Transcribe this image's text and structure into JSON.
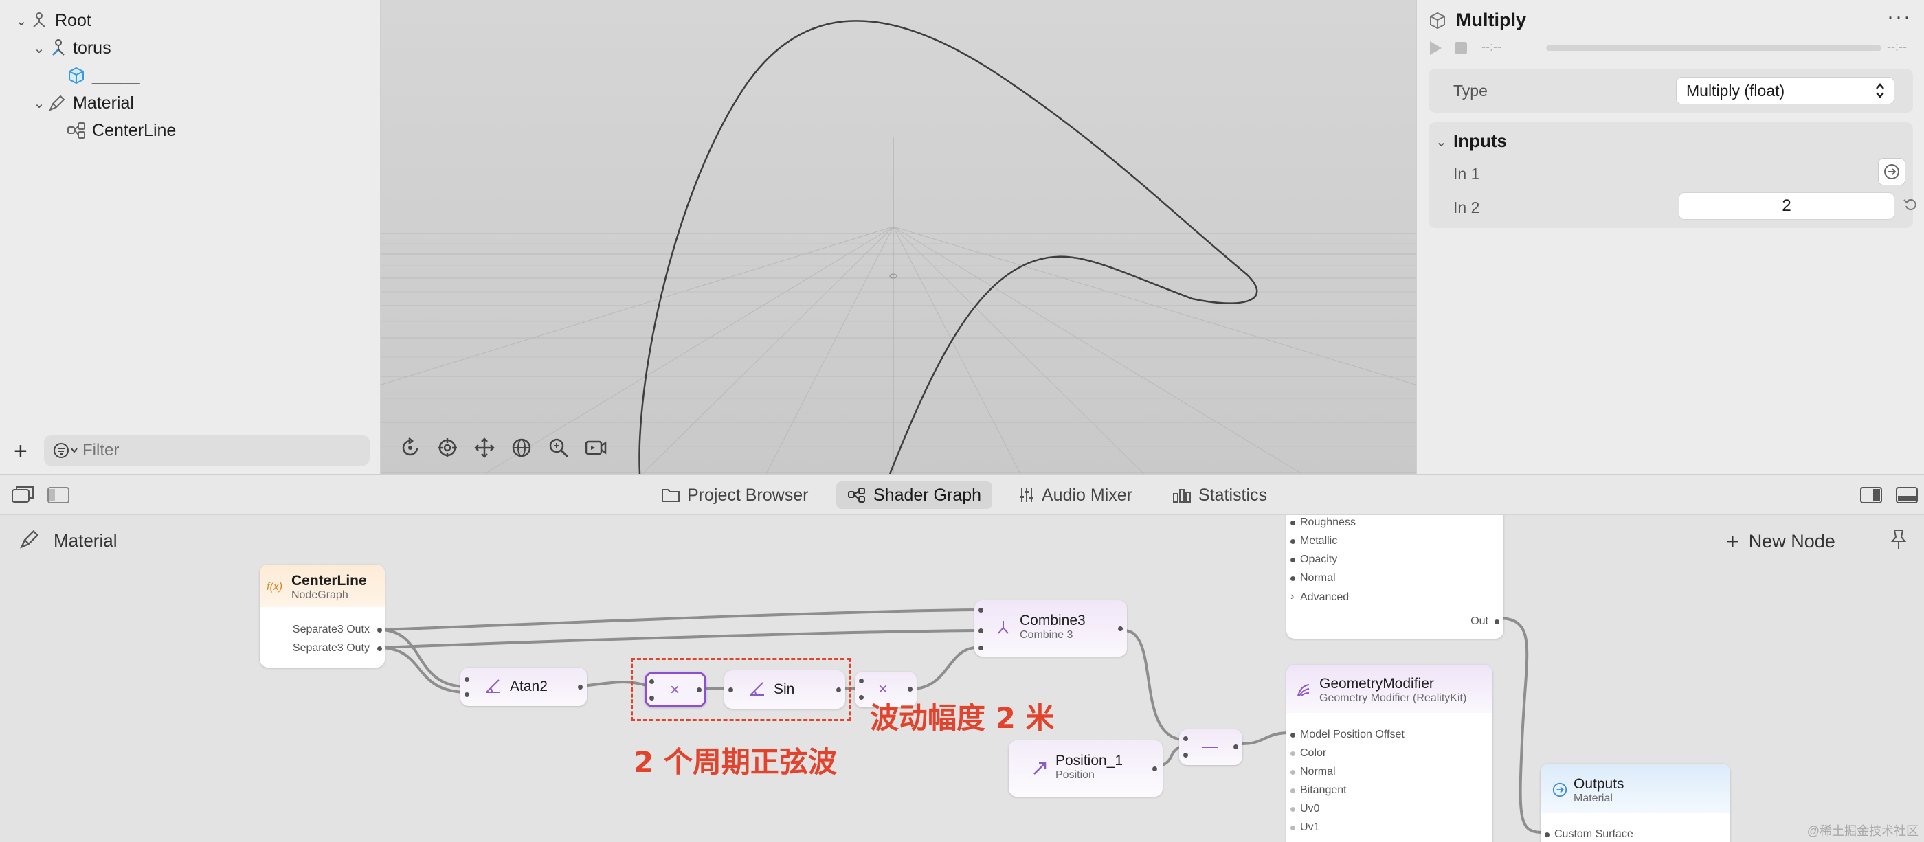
{
  "hierarchy": {
    "items": [
      {
        "label": "Root"
      },
      {
        "label": "torus"
      },
      {
        "label": "_____"
      },
      {
        "label": "Material"
      },
      {
        "label": "CenterLine"
      }
    ],
    "filter_placeholder": "Filter"
  },
  "inspector": {
    "title": "Multiply",
    "time_start": "--:--",
    "time_end": "--:--",
    "type_label": "Type",
    "type_value": "Multiply (float)",
    "inputs_header": "Inputs",
    "in1_label": "In 1",
    "in2_label": "In 2",
    "in2_value": "2"
  },
  "tabs": [
    {
      "label": "Project Browser",
      "icon": "folder-icon"
    },
    {
      "label": "Shader Graph",
      "icon": "node-graph-icon"
    },
    {
      "label": "Audio Mixer",
      "icon": "sliders-icon"
    },
    {
      "label": "Statistics",
      "icon": "bar-chart-icon"
    }
  ],
  "graph": {
    "breadcrumb": "Material",
    "new_node_label": "New Node",
    "nodes": {
      "centerline": {
        "title": "CenterLine",
        "subtitle": "NodeGraph",
        "outputs": [
          "Separate3 Outx",
          "Separate3 Outy"
        ],
        "badge": "f(x)"
      },
      "atan2": {
        "title": "Atan2"
      },
      "multiply1": {
        "symbol": "×"
      },
      "sin": {
        "title": "Sin"
      },
      "multiply2": {
        "symbol": "×"
      },
      "combine3": {
        "title": "Combine3",
        "subtitle": "Combine 3"
      },
      "position": {
        "title": "Position_1",
        "subtitle": "Position"
      },
      "subtract": {
        "symbol": "—"
      },
      "surface": {
        "ports": [
          "Roughness",
          "Metallic",
          "Opacity",
          "Normal",
          "Advanced"
        ],
        "out": "Out"
      },
      "geometry": {
        "title": "GeometryModifier",
        "subtitle": "Geometry Modifier (RealityKit)",
        "ports": [
          "Model Position Offset",
          "Color",
          "Normal",
          "Bitangent",
          "Uv0",
          "Uv1"
        ]
      },
      "outputs": {
        "title": "Outputs",
        "subtitle": "Material",
        "ports": [
          "Custom Surface"
        ]
      }
    },
    "annotations": {
      "amplitude": "波动幅度 2 米",
      "periods": "2 个周期正弦波"
    }
  },
  "watermark": "@稀土掘金技术社区"
}
